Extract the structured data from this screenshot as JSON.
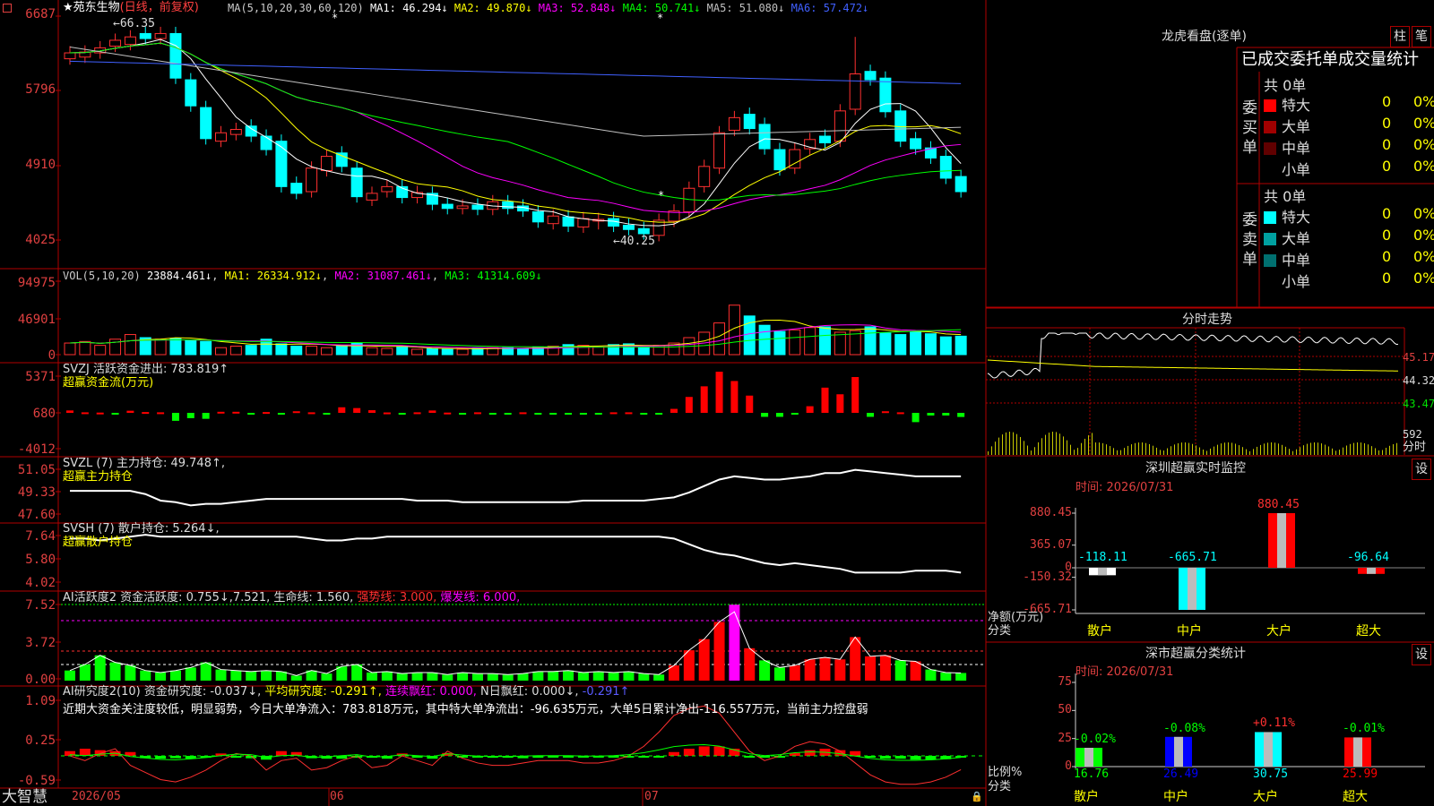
{
  "app": {
    "brand": "大智慧"
  },
  "stock": {
    "star": "★",
    "name": "苑东生物",
    "period": "(日线，前复权)"
  },
  "ma": {
    "label": "MA(5,10,20,30,60,120)",
    "items": [
      {
        "text": "MA1: 46.294↓",
        "color": "#ffffff"
      },
      {
        "text": "MA2: 49.870↓",
        "color": "#ffff00"
      },
      {
        "text": "MA3: 52.848↓",
        "color": "#ff00ff"
      },
      {
        "text": "MA4: 50.741↓",
        "color": "#00ff00"
      },
      {
        "text": "MA5: 51.080↓",
        "color": "#c0c0c0"
      },
      {
        "text": "MA6: 57.472↓",
        "color": "#4060ff"
      }
    ]
  },
  "price_axis": [
    "6687",
    "5796",
    "4910",
    "4025"
  ],
  "marks": {
    "high": "←66.35",
    "low": "←40.25"
  },
  "vol": {
    "label": "VOL(5,10,20)",
    "value": "23884.461↓",
    "ma1": "MA1: 26334.912↓",
    "ma2": "MA2: 31087.461↓",
    "ma3": "MA3: 41314.609↓",
    "axis": [
      "94975",
      "46901",
      "0"
    ]
  },
  "svzj": {
    "label": "SVZJ  活跃资金进出: 783.819↑",
    "sub": "超赢资金流(万元)",
    "axis": [
      "5371",
      "680",
      "-4012"
    ]
  },
  "svzl": {
    "label": "SVZL (7) 主力持仓: 49.748↑,",
    "sub": "超赢主力持仓",
    "axis": [
      "51.05",
      "49.33",
      "47.60"
    ]
  },
  "svsh": {
    "label": "SVSH (7) 散户持仓: 5.264↓,",
    "sub": "超赢散户持仓",
    "axis": [
      "7.64",
      "5.80",
      "4.02"
    ]
  },
  "ai1": {
    "label": "AI活跃度2 资金活跃度: 0.755↓,7.521, 生命线: 1.560,",
    "strong": "强势线: 3.000,",
    "burst": "爆发线: 6.000,",
    "axis": [
      "7.52",
      "3.72",
      "0.00"
    ]
  },
  "ai2": {
    "label": "AI研究度2(10) 资金研究度: -0.037↓,",
    "avg": "平均研究度: -0.291↑,",
    "red": "连续飘红: 0.000,",
    "nred": "N日飘红: 0.000↓,",
    "tail": "-0.291↑",
    "text": "近期大资金关注度较低，明显弱势，今日大单净流入：783.818万元，其中特大单净流出：-96.635万元，大单5日累计净出-116.557万元，当前主力控盘弱",
    "axis": [
      "1.09",
      "0.25",
      "-0.59"
    ]
  },
  "dates": [
    "2026/05",
    "06",
    "07"
  ],
  "right": {
    "dragon": {
      "title": "龙虎看盘(逐单)",
      "btn1": "柱",
      "btn2": "笔",
      "header": "已成交委托单成交量统计"
    },
    "buy": {
      "side": "委买单",
      "total": "共 0单",
      "rows": [
        {
          "name": "特大",
          "v": "0",
          "p": "0%",
          "c": "#ff0000"
        },
        {
          "name": "大单",
          "v": "0",
          "p": "0%",
          "c": "#a00000"
        },
        {
          "name": "中单",
          "v": "0",
          "p": "0%",
          "c": "#600000"
        },
        {
          "name": "小单",
          "v": "0",
          "p": "0%",
          "c": "#000000"
        }
      ]
    },
    "sell": {
      "side": "委卖单",
      "total": "共 0单",
      "rows": [
        {
          "name": "特大",
          "v": "0",
          "p": "0%",
          "c": "#00ffff"
        },
        {
          "name": "大单",
          "v": "0",
          "p": "0%",
          "c": "#00a0a0"
        },
        {
          "name": "中单",
          "v": "0",
          "p": "0%",
          "c": "#007070"
        },
        {
          "name": "小单",
          "v": "0",
          "p": "0%",
          "c": "#000000"
        }
      ]
    },
    "intraday": {
      "title": "分时走势",
      "axis": [
        "45.17",
        "44.32",
        "43.47"
      ],
      "vol": "592",
      "vol_label": "分时"
    },
    "monitor": {
      "title": "深圳超赢实时监控",
      "btn": "设",
      "time": "时间: 2026/07/31",
      "axis": [
        "880.45",
        "365.07",
        "0",
        "-150.32",
        "-665.71"
      ],
      "ylabel": "净额(万元)",
      "xlabel": "分类"
    },
    "cls": {
      "title": "深市超赢分类统计",
      "btn": "设",
      "time": "时间: 2026/07/31",
      "axis": [
        "75",
        "50",
        "25",
        "0"
      ],
      "ylabel": "比例%",
      "xlabel": "分类"
    }
  },
  "chart_data": [
    {
      "type": "bar",
      "title": "深圳超赢实时监控",
      "categories": [
        "散户",
        "中户",
        "大户",
        "超大"
      ],
      "values": [
        -118.11,
        -665.71,
        880.45,
        -96.64
      ],
      "value_labels": [
        "-118.11",
        "-665.71",
        "880.45",
        "-96.64"
      ],
      "colors": [
        "#ffffff",
        "#00ffff",
        "#ff0000",
        "#ff0000"
      ],
      "ylabel": "净额(万元)",
      "xlabel": "分类",
      "ylim": [
        -665.71,
        880.45
      ],
      "ticks": [
        880.45,
        365.07,
        0,
        -150.32,
        -665.71
      ]
    },
    {
      "type": "bar",
      "title": "深市超赢分类统计",
      "categories": [
        "散户",
        "中户",
        "大户",
        "超大"
      ],
      "values": [
        16.76,
        26.49,
        30.75,
        25.99
      ],
      "changes": [
        "-0.02%",
        "-0.08%",
        "+0.11%",
        "-0.01%"
      ],
      "colors": [
        "#00ff00",
        "#0000ff",
        "#00ffff",
        "#ff0000"
      ],
      "ylabel": "比例%",
      "xlabel": "分类",
      "ylim": [
        0,
        75
      ],
      "ticks": [
        75,
        50,
        25,
        0
      ]
    }
  ]
}
